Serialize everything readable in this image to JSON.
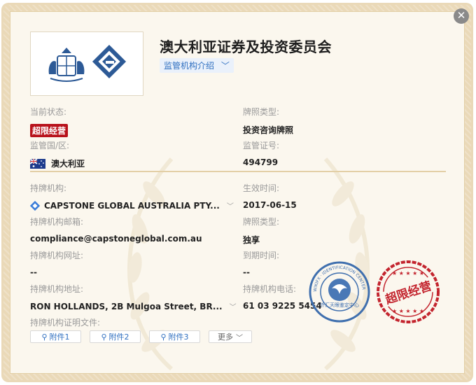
{
  "header": {
    "org_name": "澳大利亚证券及投资委员会",
    "intro_label": "监管机构介绍"
  },
  "fields": {
    "status_label": "当前状态:",
    "status_value": "超限经营",
    "license_type_label": "牌照类型:",
    "license_type_value": "投资咨询牌照",
    "region_label": "监管国/区:",
    "region_value": "澳大利亚",
    "license_no_label": "监管证号:",
    "license_no_value": "494799",
    "holder_label": "持牌机构:",
    "holder_value": "CAPSTONE GLOBAL AUSTRALIA PTY...",
    "effective_label": "生效时间:",
    "effective_value": "2017-06-15",
    "email_label": "持牌机构邮箱:",
    "email_value": "compliance@capstoneglobal.com.au",
    "share_type_label": "牌照类型:",
    "share_type_value": "独享",
    "website_label": "持牌机构网址:",
    "website_value": "--",
    "expiry_label": "到期时间:",
    "expiry_value": "--",
    "address_label": "持牌机构地址:",
    "address_value": "RON HOLLANDS, 2B Mulgoa Street, BR...",
    "phone_label": "持牌机构电话:",
    "phone_value": "61 03 9225 5454",
    "docs_label": "持牌机构证明文件:"
  },
  "attachments": [
    "附件1",
    "附件2",
    "附件3"
  ],
  "more_label": "更多",
  "stamps": {
    "blue_text": "外汇天眼鉴定中心",
    "blue_ring": "WIKIFX · IDENTIFICATION CENTER",
    "red_text": "超限经营"
  },
  "colors": {
    "accent_blue": "#2f6fc0",
    "status_red": "#b8121b",
    "frame_gold": "#ead9b8"
  }
}
